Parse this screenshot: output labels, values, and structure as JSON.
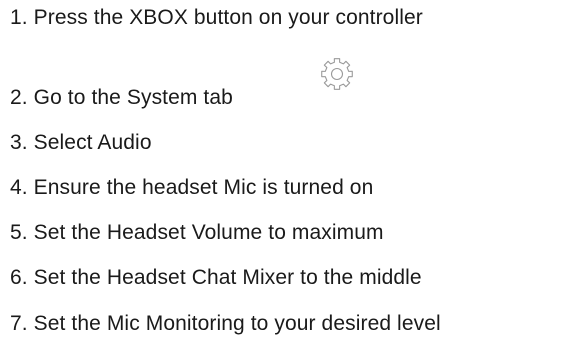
{
  "steps": [
    {
      "number": "1.",
      "text": "Press the XBOX button on your controller"
    },
    {
      "number": "2.",
      "text": "Go to the System tab"
    },
    {
      "number": "3.",
      "text": "Select Audio"
    },
    {
      "number": "4.",
      "text": "Ensure the headset Mic is turned on"
    },
    {
      "number": "5.",
      "text": "Set the Headset Volume to maximum"
    },
    {
      "number": "6.",
      "text": "Set the Headset Chat Mixer to the middle"
    },
    {
      "number": "7.",
      "text": "Set the Mic Monitoring to your desired level"
    }
  ],
  "icons": {
    "settings": "gear-icon",
    "stroke_color": "#9a9a9a"
  },
  "colors": {
    "text": "#1a1a1a",
    "background": "#ffffff"
  }
}
